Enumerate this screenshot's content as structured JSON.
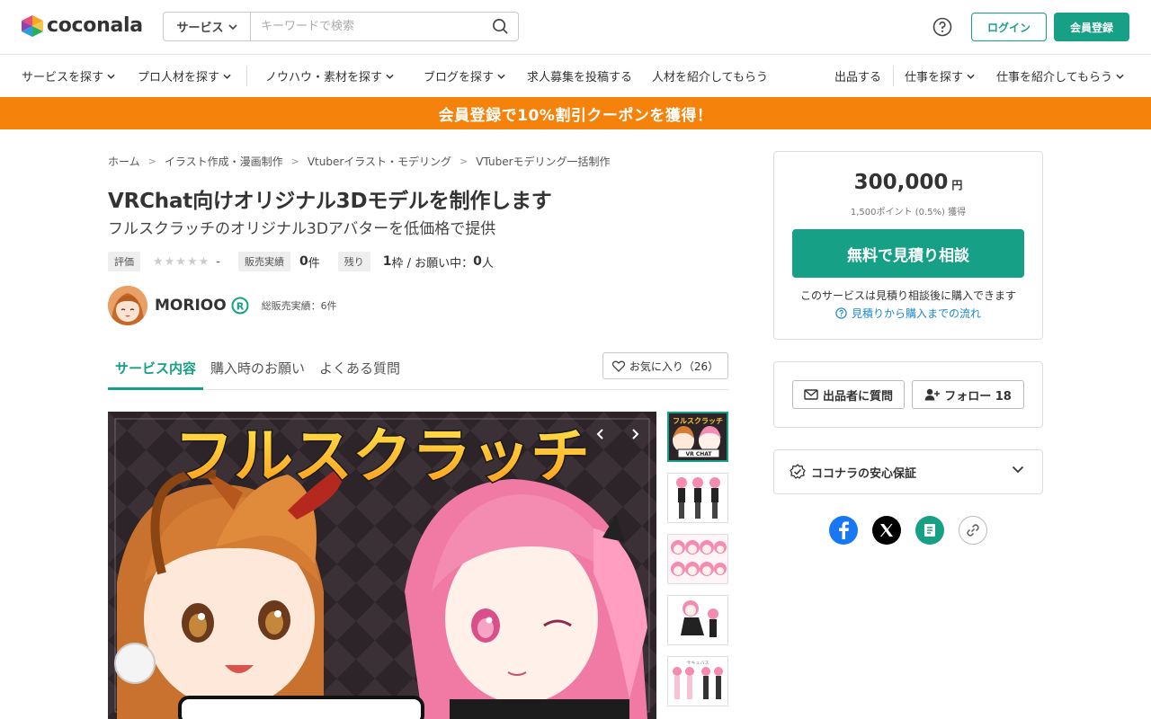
{
  "header": {
    "logo_text": "coconala",
    "search_category": "サービス",
    "search_placeholder": "キーワードで検索",
    "login_label": "ログイン",
    "signup_label": "会員登録"
  },
  "nav": {
    "left": [
      "サービスを探す",
      "プロ人材を探す",
      "ノウハウ・素材を探す",
      "ブログを探す",
      "求人募集を投稿する",
      "人材を紹介してもらう"
    ],
    "right": [
      "出品する",
      "仕事を探す",
      "仕事を紹介してもらう"
    ]
  },
  "banner": {
    "text": "会員登録で10%割引クーポンを獲得！"
  },
  "breadcrumb": [
    "ホーム",
    "イラスト作成・漫画制作",
    "Vtuberイラスト・モデリング",
    "VTuberモデリング一括制作"
  ],
  "service": {
    "title": "VRChat向けオリジナル3Dモデルを制作します",
    "subtitle": "フルスクラッチのオリジナル3Dアバターを低価格で提供",
    "rating_label": "評価",
    "stars": "★★★★★",
    "rating_value": "-",
    "sales_label": "販売実績",
    "sales_count": "0",
    "sales_unit": "件",
    "remaining_label": "残り",
    "remaining_count": "1",
    "remaining_unit": "枠 / お願い中：",
    "requesting_count": "0",
    "requesting_unit": "人"
  },
  "seller": {
    "name": "MORIOO",
    "total_sales": "総販売実績：6件"
  },
  "tabs": [
    "サービス内容",
    "購入時のお願い",
    "よくある質問"
  ],
  "favorite_label": "お気に入り（26）",
  "main_image": {
    "headline": "フルスクラッチ",
    "thumb_caption_1": "フルスクラッチ",
    "thumb_caption_2": "VR CHAT",
    "thumb_caption_5": "サキュバス"
  },
  "sidebar": {
    "price": "300,000",
    "price_unit": "円",
    "points": "1,500ポイント (0.5%) 獲得",
    "consult_label": "無料で見積り相談",
    "consult_note": "このサービスは見積り相談後に購入できます",
    "flow_link": "見積りから購入までの流れ",
    "ask_label": "出品者に質問",
    "follow_label": "フォロー 18",
    "guarantee_label": "ココナラの安心保証"
  },
  "colors": {
    "brand_green": "#16a085",
    "banner_orange": "#f5820b",
    "link_blue": "#1d88c9"
  }
}
